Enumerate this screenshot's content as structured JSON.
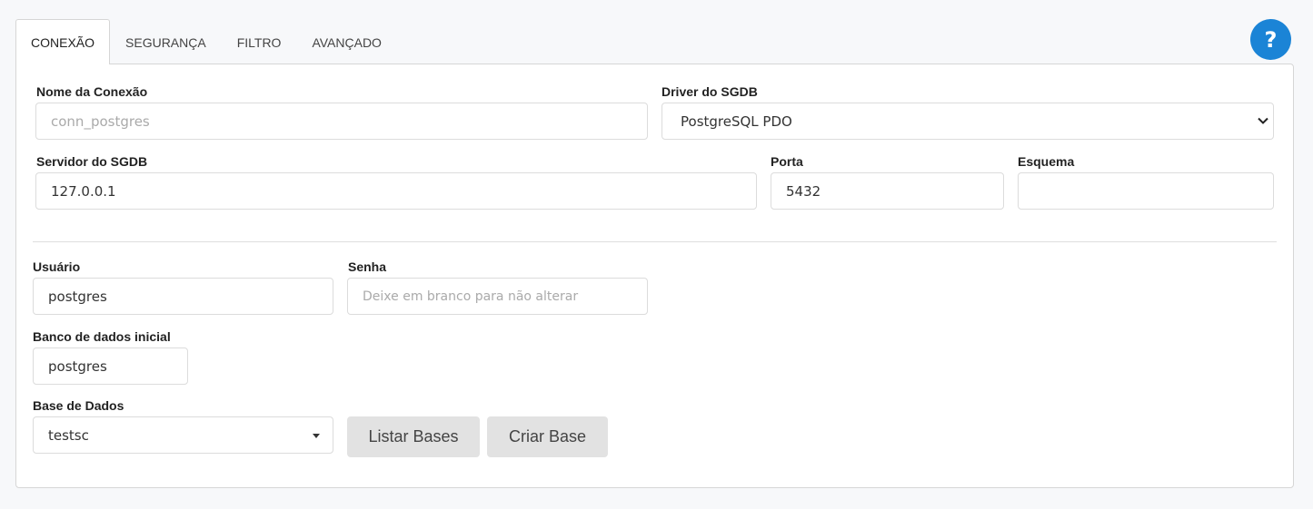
{
  "tabs": [
    {
      "label": "CONEXÃO",
      "active": true
    },
    {
      "label": "SEGURANÇA",
      "active": false
    },
    {
      "label": "FILTRO",
      "active": false
    },
    {
      "label": "AVANÇADO",
      "active": false
    }
  ],
  "help_button": {
    "label": "?"
  },
  "form": {
    "connection_name": {
      "label": "Nome da Conexão",
      "value": "conn_postgres"
    },
    "driver": {
      "label": "Driver do SGDB",
      "value": "PostgreSQL PDO"
    },
    "server": {
      "label": "Servidor do SGDB",
      "value": "127.0.0.1"
    },
    "port": {
      "label": "Porta",
      "value": "5432"
    },
    "schema": {
      "label": "Esquema",
      "value": ""
    },
    "user": {
      "label": "Usuário",
      "value": "postgres"
    },
    "password": {
      "label": "Senha",
      "placeholder": "Deixe em branco para não alterar"
    },
    "initial_db": {
      "label": "Banco de dados inicial",
      "value": "postgres"
    },
    "database": {
      "label": "Base de Dados",
      "value": "testsc"
    }
  },
  "buttons": {
    "list_bases": "Listar Bases",
    "create_base": "Criar Base"
  }
}
